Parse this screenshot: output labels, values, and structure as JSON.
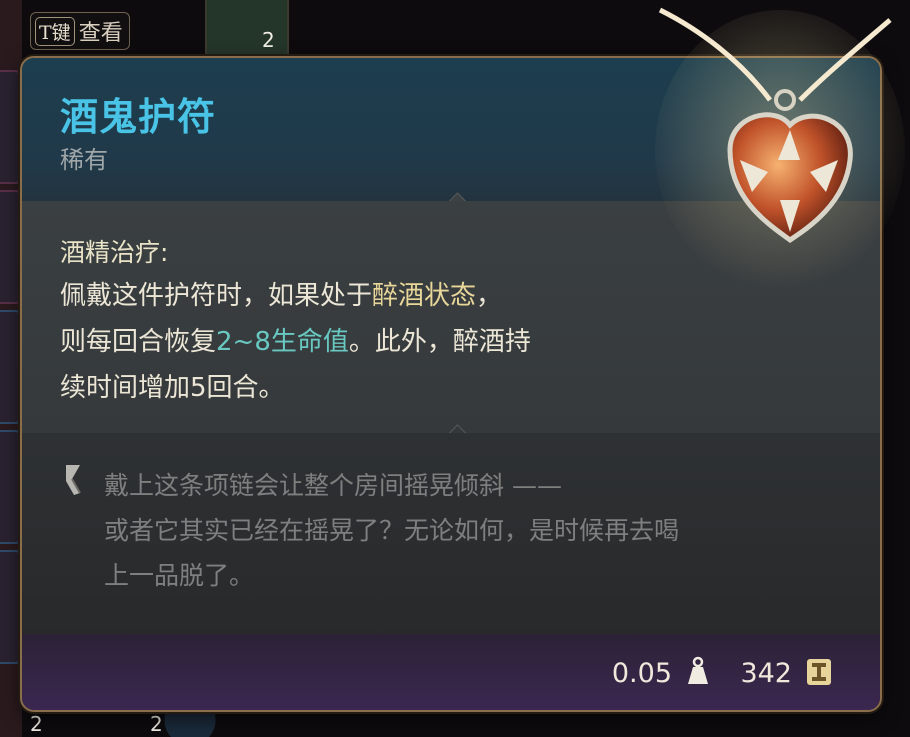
{
  "hotkey": {
    "key": "T键",
    "label": "查看"
  },
  "item": {
    "name": "酒鬼护符",
    "rarity": "稀有",
    "ability": {
      "name": "酒精治疗:",
      "line1_a": "佩戴这件护符时，如果处于",
      "line1_hl": "醉酒状态",
      "line1_b": "，",
      "line2_a": "则每回合恢复",
      "line2_hl": "2~8生命值",
      "line2_b": "。此外，醉酒持",
      "line3": "续时间增加5回合。"
    },
    "flavor": {
      "line1": "戴上这条项链会让整个房间摇晃倾斜 ——",
      "line2": "或者它其实已经在摇晃了？无论如何，是时候再去喝",
      "line3": "上一品脱了。"
    },
    "weight": "0.05",
    "price": "342",
    "icons": {
      "weight": "weight-icon",
      "price": "gold-coin-icon",
      "flavor": "quill-icon",
      "image": "amulet-icon"
    }
  },
  "inventory": {
    "slot_counts": [
      "2",
      "2",
      "2"
    ]
  },
  "colors": {
    "title": "#49c4e6",
    "highlight_gold": "#e9d79a",
    "highlight_teal": "#69c8c2",
    "border": "#8a6e4b",
    "footer": "#3b2750"
  }
}
